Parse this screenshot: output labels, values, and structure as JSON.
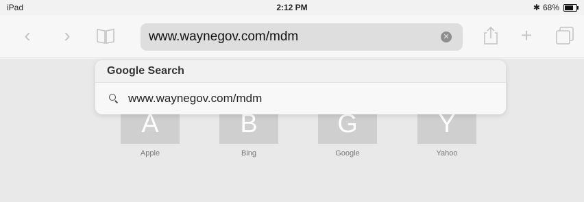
{
  "status_bar": {
    "device": "iPad",
    "time": "2:12 PM",
    "bluetooth": "✱",
    "battery": "68%",
    "battery_level": 0.68
  },
  "toolbar": {
    "address": "www.waynegov.com/mdm",
    "icons": [
      "back-icon",
      "forward-icon",
      "bookmarks-icon",
      "clear-icon",
      "share-icon",
      "plus-icon",
      "tabs-icon"
    ]
  },
  "dropdown": {
    "header": "Google Search",
    "suggestion": "www.waynegov.com/mdm"
  },
  "favorites": [
    {
      "letter": "A",
      "label": "Apple"
    },
    {
      "letter": "B",
      "label": "Bing"
    },
    {
      "letter": "G",
      "label": "Google"
    },
    {
      "letter": "Y",
      "label": "Yahoo"
    }
  ],
  "colors": {
    "background": "#f2f2f2",
    "address_bar": "#dedede",
    "tile": "#cfcfcf"
  }
}
